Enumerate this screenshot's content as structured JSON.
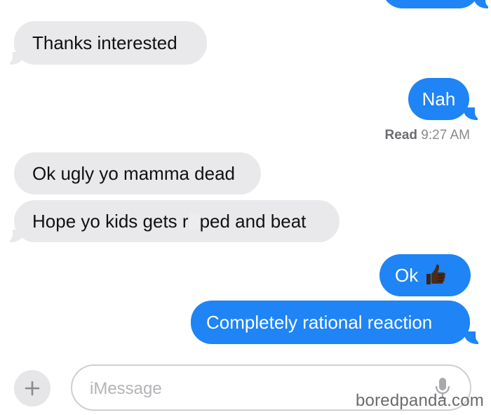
{
  "messages": [
    {
      "id": "m0",
      "direction": "outgoing",
      "text": ""
    },
    {
      "id": "m1",
      "direction": "incoming",
      "text": "Thanks interested"
    },
    {
      "id": "m2",
      "direction": "outgoing",
      "text": "Nah"
    },
    {
      "id": "m3",
      "direction": "incoming",
      "text": "Ok ugly yo mamma dead"
    },
    {
      "id": "m4",
      "direction": "incoming",
      "text_before": "Hope yo kids gets r",
      "text_after": "ped and beat"
    },
    {
      "id": "m5",
      "direction": "outgoing",
      "text": "Ok",
      "emoji": "thumbs-up-icon"
    },
    {
      "id": "m6",
      "direction": "outgoing",
      "text": "Completely rational reaction"
    }
  ],
  "receipt": {
    "status": "Read",
    "time": "9:27 AM"
  },
  "composer": {
    "placeholder": "iMessage",
    "plus_icon": "plus-icon",
    "mic_icon": "microphone-icon"
  },
  "watermark": "boredpanda.com",
  "colors": {
    "outgoing": "#1f84f5",
    "incoming": "#e9e9eb",
    "placeholder": "#b4b4b8"
  }
}
